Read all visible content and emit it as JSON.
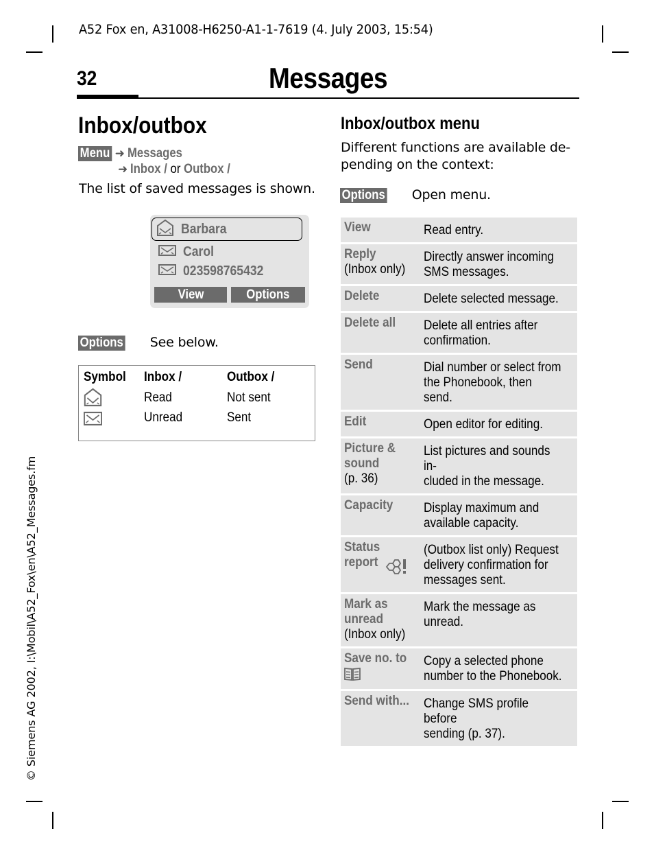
{
  "doc_header": "A52 Fox en, A31008-H6250-A1-1-7619 (4. July 2003, 15:54)",
  "page_number": "32",
  "chapter_title": "Messages",
  "side_note": "© Siemens AG 2002, I:\\Mobil\\A52_Fox\\en\\A52_Messages.fm",
  "left": {
    "section_title": "Inbox/outbox",
    "nav": {
      "menu_key": "Menu",
      "step1": "Messages",
      "step2a": "Inbox /",
      "step2_or": "or",
      "step2b": "Outbox /"
    },
    "list_shown": "The list of saved messages is shown.",
    "phone_display": {
      "items": [
        {
          "icon": "envelope-open-icon",
          "label": "Barbara",
          "selected": true
        },
        {
          "icon": "envelope-closed-icon",
          "label": "Carol",
          "selected": false
        },
        {
          "icon": "envelope-closed-icon",
          "label": "023598765432",
          "selected": false
        }
      ],
      "softkey_left": "View",
      "softkey_right": "Options"
    },
    "options_key": "Options",
    "options_text": "See below.",
    "symbol_table": {
      "headers": [
        "Symbol",
        "Inbox /",
        "Outbox /"
      ],
      "rows": [
        {
          "icon": "envelope-open-icon",
          "inbox": "Read",
          "outbox": "Not sent"
        },
        {
          "icon": "envelope-closed-icon",
          "inbox": "Unread",
          "outbox": "Sent"
        }
      ]
    }
  },
  "right": {
    "sub_title": "Inbox/outbox menu",
    "intro": "Different functions are available de-pending on the context:",
    "intro_line1": "Different functions are available de-",
    "intro_line2": "pending on the context:",
    "options_key": "Options",
    "options_text": "Open menu.",
    "menu_items": [
      {
        "name": "View",
        "note": "",
        "desc": "Read entry."
      },
      {
        "name": "Reply",
        "note": "(Inbox only)",
        "desc": "Directly answer incoming\nSMS messages."
      },
      {
        "name": "Delete",
        "note": "",
        "desc": "Delete selected message."
      },
      {
        "name": "Delete all",
        "note": "",
        "desc": "Delete all entries after\nconfirmation."
      },
      {
        "name": "Send",
        "note": "",
        "desc": "Dial number or select from\nthe Phonebook, then send."
      },
      {
        "name": "Edit",
        "note": "",
        "desc": "Open editor for editing."
      },
      {
        "name": "Picture &\nsound",
        "note": "(p. 36)",
        "desc": "List pictures and sounds in-\ncluded in the message."
      },
      {
        "name": "Capacity",
        "note": "",
        "desc": "Display maximum and\navailable capacity."
      },
      {
        "name": "Status\nreport",
        "icon": "status-report-icon",
        "note": "",
        "desc": "(Outbox list only) Request\ndelivery confirmation for\nmessages sent."
      },
      {
        "name": "Mark as\nunread",
        "note": "(Inbox only)",
        "desc": "Mark the message as\nunread."
      },
      {
        "name": "Save no. to",
        "icon": "phonebook-icon",
        "note": "",
        "desc": "Copy a selected phone\nnumber to the Phonebook."
      },
      {
        "name": "Send with...",
        "note": "",
        "desc": "Change SMS profile before\nsending (p. 37)."
      }
    ]
  }
}
